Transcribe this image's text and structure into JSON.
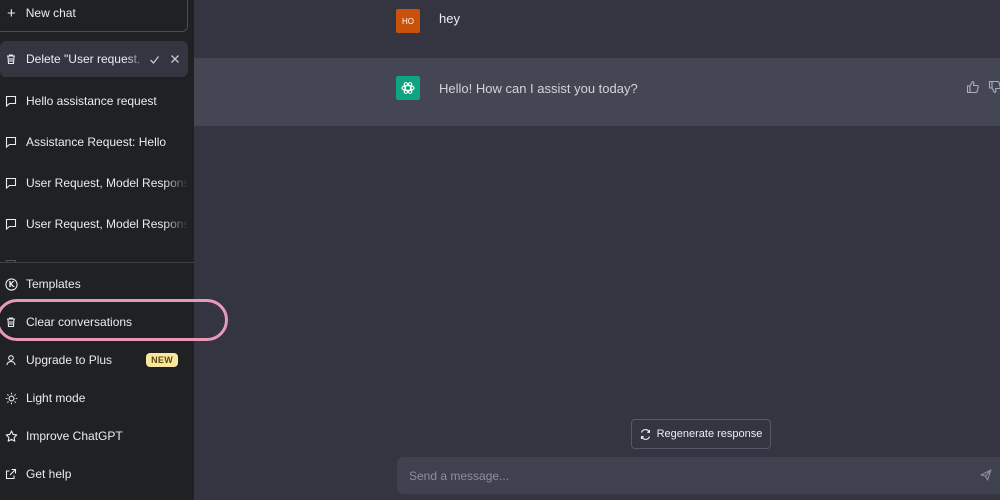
{
  "sidebar": {
    "new_chat_label": "New chat",
    "conversations": [
      {
        "label": "Delete \"User request, m",
        "active": true
      },
      {
        "label": "Hello assistance request"
      },
      {
        "label": "Assistance Request: Hello"
      },
      {
        "label": "User Request, Model Respons"
      },
      {
        "label": "User Request, Model Respons"
      }
    ],
    "menu": {
      "templates": "Templates",
      "clear": "Clear conversations",
      "upgrade": "Upgrade to Plus",
      "upgrade_badge": "NEW",
      "light_mode": "Light mode",
      "improve": "Improve ChatGPT",
      "help": "Get help"
    }
  },
  "chat": {
    "user_initials": "HO",
    "user_message": "hey",
    "bot_message": "Hello! How can I assist you today?"
  },
  "regenerate_label": "Regenerate response",
  "input": {
    "placeholder": "Send a message..."
  },
  "colors": {
    "sidebar_bg": "#202123",
    "main_bg": "#343541",
    "bot_row_bg": "#444654",
    "user_avatar": "#c9510c",
    "bot_avatar": "#10a37f",
    "badge_bg": "#fae69e",
    "highlight": "#e79ab6"
  },
  "icons": {
    "new_chat": "plus-icon",
    "trash": "trash-icon",
    "chat": "chat-bubble-icon",
    "templates": "k-circle-icon",
    "user": "user-icon",
    "light": "sun-icon",
    "improve": "star-icon",
    "help": "external-link-icon",
    "regen": "refresh-icon",
    "send": "send-icon",
    "like": "thumbs-up-icon",
    "dislike": "thumbs-down-icon"
  }
}
